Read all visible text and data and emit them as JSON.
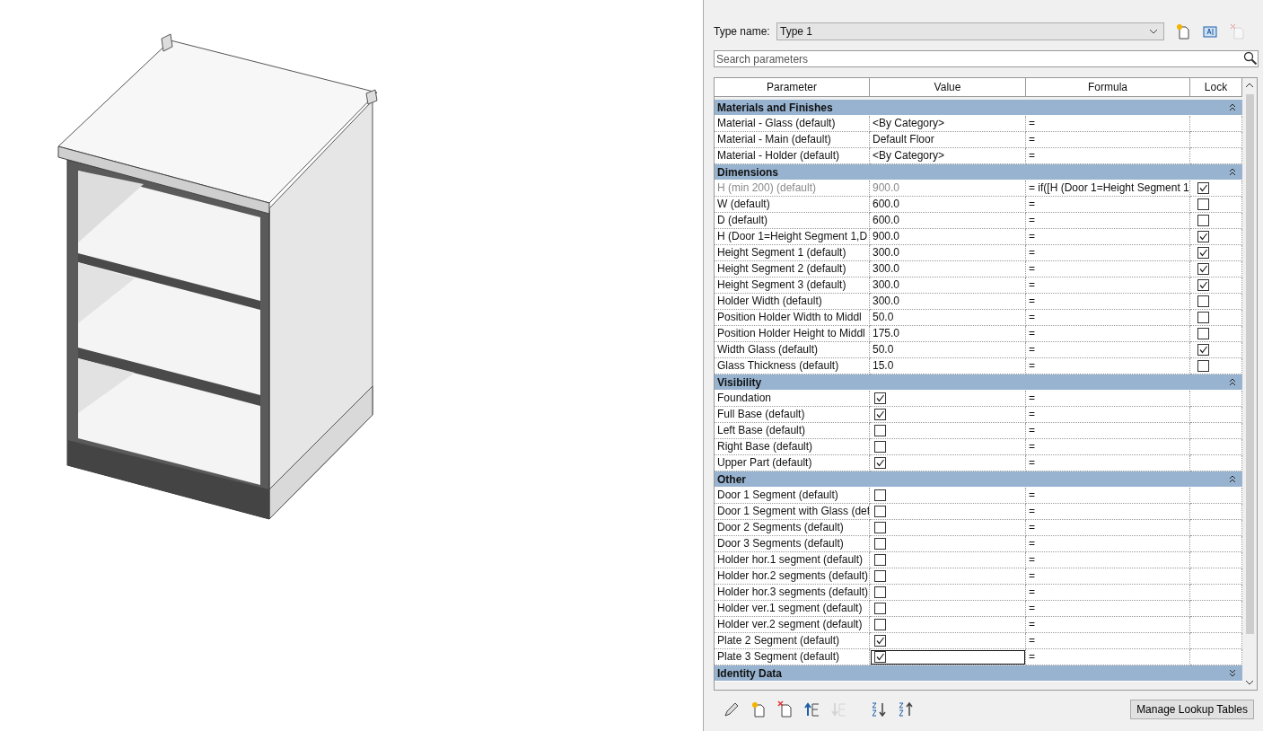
{
  "type_name": {
    "label": "Type name:",
    "value": "Type 1"
  },
  "type_tools": [
    {
      "kind": "new",
      "disabled": false
    },
    {
      "kind": "rename",
      "disabled": false
    },
    {
      "kind": "delete",
      "disabled": true
    }
  ],
  "search": {
    "placeholder": "Search parameters"
  },
  "columns": [
    "Parameter",
    "Value",
    "Formula",
    "Lock"
  ],
  "groups": [
    {
      "name": "Materials and Finishes",
      "expanded": true,
      "rows": [
        {
          "parameter": "Material - Glass (default)",
          "kind": "text",
          "value": "<By Category>",
          "formula": "=",
          "disabled": false,
          "selected": false
        },
        {
          "parameter": "Material - Main (default)",
          "kind": "text",
          "value": "Default Floor",
          "formula": "=",
          "disabled": false,
          "selected": false
        },
        {
          "parameter": "Material - Holder (default)",
          "kind": "text",
          "value": "<By Category>",
          "formula": "=",
          "disabled": false,
          "selected": false
        }
      ]
    },
    {
      "name": "Dimensions",
      "expanded": true,
      "rows": [
        {
          "parameter": "H (min 200) (default)",
          "kind": "text",
          "value": "900.0",
          "formula": "= if([H (Door 1=Height Segment 1",
          "locked": true,
          "disabled": true,
          "selected": false
        },
        {
          "parameter": "W (default)",
          "kind": "text",
          "value": "600.0",
          "formula": "=",
          "locked": false,
          "disabled": false,
          "selected": false
        },
        {
          "parameter": "D (default)",
          "kind": "text",
          "value": "600.0",
          "formula": "=",
          "locked": false,
          "disabled": false,
          "selected": false
        },
        {
          "parameter": "H (Door 1=Height Segment 1,D",
          "kind": "text",
          "value": "900.0",
          "formula": "=",
          "locked": true,
          "disabled": false,
          "selected": false
        },
        {
          "parameter": "Height Segment 1 (default)",
          "kind": "text",
          "value": "300.0",
          "formula": "=",
          "locked": true,
          "disabled": false,
          "selected": false
        },
        {
          "parameter": "Height Segment 2 (default)",
          "kind": "text",
          "value": "300.0",
          "formula": "=",
          "locked": true,
          "disabled": false,
          "selected": false
        },
        {
          "parameter": "Height Segment 3 (default)",
          "kind": "text",
          "value": "300.0",
          "formula": "=",
          "locked": true,
          "disabled": false,
          "selected": false
        },
        {
          "parameter": "Holder Width (default)",
          "kind": "text",
          "value": "300.0",
          "formula": "=",
          "locked": false,
          "disabled": false,
          "selected": false
        },
        {
          "parameter": "Position Holder Width to Middl",
          "kind": "text",
          "value": "50.0",
          "formula": "=",
          "locked": false,
          "disabled": false,
          "selected": false
        },
        {
          "parameter": "Position Holder Height to Middl",
          "kind": "text",
          "value": "175.0",
          "formula": "=",
          "locked": false,
          "disabled": false,
          "selected": false
        },
        {
          "parameter": "Width Glass (default)",
          "kind": "text",
          "value": "50.0",
          "formula": "=",
          "locked": true,
          "disabled": false,
          "selected": false
        },
        {
          "parameter": "Glass Thickness (default)",
          "kind": "text",
          "value": "15.0",
          "formula": "=",
          "locked": false,
          "disabled": false,
          "selected": false
        }
      ]
    },
    {
      "name": "Visibility",
      "expanded": true,
      "rows": [
        {
          "parameter": "Foundation",
          "kind": "checkbox",
          "checked": true,
          "formula": "=",
          "disabled": false,
          "selected": false
        },
        {
          "parameter": "Full Base (default)",
          "kind": "checkbox",
          "checked": true,
          "formula": "=",
          "disabled": false,
          "selected": false
        },
        {
          "parameter": "Left Base (default)",
          "kind": "checkbox",
          "checked": false,
          "formula": "=",
          "disabled": false,
          "selected": false
        },
        {
          "parameter": "Right Base (default)",
          "kind": "checkbox",
          "checked": false,
          "formula": "=",
          "disabled": false,
          "selected": false
        },
        {
          "parameter": "Upper Part (default)",
          "kind": "checkbox",
          "checked": true,
          "formula": "=",
          "disabled": false,
          "selected": false
        }
      ]
    },
    {
      "name": "Other",
      "expanded": true,
      "rows": [
        {
          "parameter": "Door 1 Segment (default)",
          "kind": "checkbox",
          "checked": false,
          "formula": "=",
          "disabled": false,
          "selected": false
        },
        {
          "parameter": "Door 1 Segment with Glass (def",
          "kind": "checkbox",
          "checked": false,
          "formula": "=",
          "disabled": false,
          "selected": false
        },
        {
          "parameter": "Door 2 Segments (default)",
          "kind": "checkbox",
          "checked": false,
          "formula": "=",
          "disabled": false,
          "selected": false
        },
        {
          "parameter": "Door 3 Segments (default)",
          "kind": "checkbox",
          "checked": false,
          "formula": "=",
          "disabled": false,
          "selected": false
        },
        {
          "parameter": "Holder hor.1 segment (default)",
          "kind": "checkbox",
          "checked": false,
          "formula": "=",
          "disabled": false,
          "selected": false
        },
        {
          "parameter": "Holder hor.2 segments (default)",
          "kind": "checkbox",
          "checked": false,
          "formula": "=",
          "disabled": false,
          "selected": false
        },
        {
          "parameter": "Holder hor.3 segments (default)",
          "kind": "checkbox",
          "checked": false,
          "formula": "=",
          "disabled": false,
          "selected": false
        },
        {
          "parameter": "Holder ver.1 segment (default)",
          "kind": "checkbox",
          "checked": false,
          "formula": "=",
          "disabled": false,
          "selected": false
        },
        {
          "parameter": "Holder ver.2 segment (default)",
          "kind": "checkbox",
          "checked": false,
          "formula": "=",
          "disabled": false,
          "selected": false
        },
        {
          "parameter": "Plate 2 Segment (default)",
          "kind": "checkbox",
          "checked": true,
          "formula": "=",
          "disabled": false,
          "selected": false
        },
        {
          "parameter": "Plate 3 Segment (default)",
          "kind": "checkbox",
          "checked": true,
          "formula": "=",
          "disabled": false,
          "selected": true
        }
      ]
    },
    {
      "name": "Identity Data",
      "expanded": false
    }
  ],
  "toolbar": [
    {
      "kind": "edit",
      "disabled": false
    },
    {
      "kind": "new",
      "disabled": false
    },
    {
      "kind": "delete",
      "disabled": false
    },
    {
      "kind": "move-up",
      "disabled": false
    },
    {
      "kind": "move-down",
      "disabled": true
    },
    {
      "kind": "sort-ascending",
      "disabled": false
    },
    {
      "kind": "sort-descending",
      "disabled": false
    }
  ],
  "lookup_button": "Manage Lookup Tables"
}
